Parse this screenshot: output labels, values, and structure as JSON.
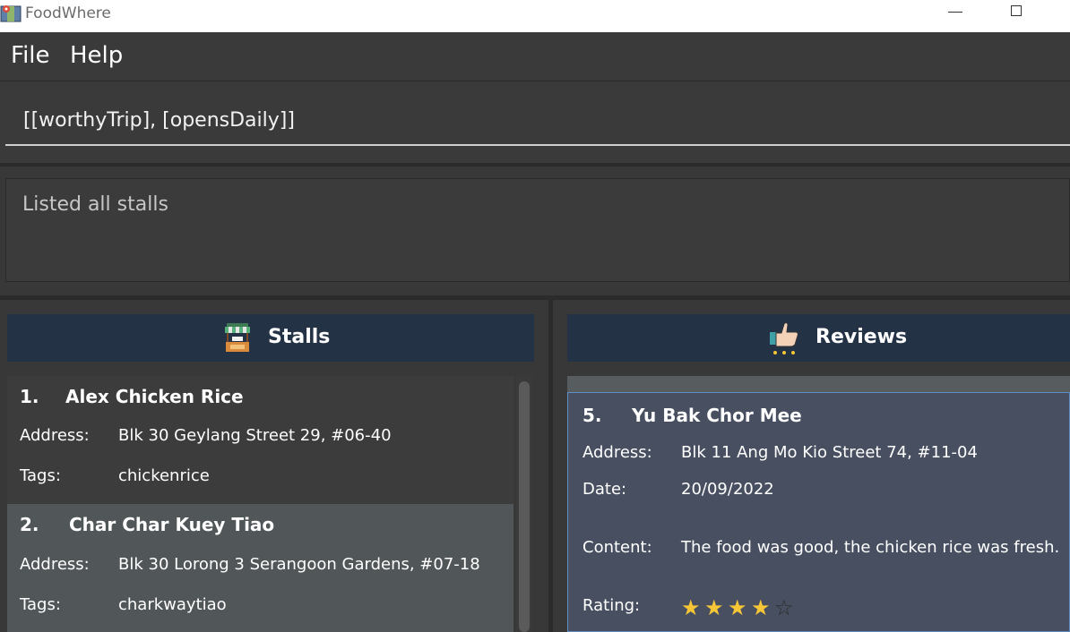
{
  "window": {
    "title": "FoodWhere"
  },
  "menu": {
    "file_label": "File",
    "help_label": "Help"
  },
  "command": {
    "value": "[[worthyTrip], [opensDaily]]"
  },
  "result": {
    "message": "Listed all stalls"
  },
  "stalls_panel": {
    "title": "Stalls",
    "items": [
      {
        "index": "1.",
        "name": "Alex Chicken Rice",
        "address_label": "Address:",
        "address": "Blk 30 Geylang Street 29, #06-40",
        "tags_label": "Tags:",
        "tags": "chickenrice"
      },
      {
        "index": "2.",
        "name": "Char Char Kuey Tiao",
        "address_label": "Address:",
        "address": "Blk 30 Lorong 3 Serangoon Gardens, #07-18",
        "tags_label": "Tags:",
        "tags": "charkwaytiao"
      }
    ]
  },
  "reviews_panel": {
    "title": "Reviews",
    "items": [
      {
        "index": "5.",
        "name": "Yu Bak Chor Mee",
        "address_label": "Address:",
        "address": "Blk 11 Ang Mo Kio Street 74, #11-04",
        "date_label": "Date:",
        "date": "20/09/2022",
        "content_label": "Content:",
        "content": "The food was good, the chicken rice was fresh.",
        "rating_label": "Rating:",
        "rating": 4,
        "rating_max": 5
      }
    ]
  },
  "colors": {
    "header_bg": "#243246",
    "selected_card_bg": "#515658",
    "review_card_bg": "#474f60",
    "star": "#f7c637"
  }
}
